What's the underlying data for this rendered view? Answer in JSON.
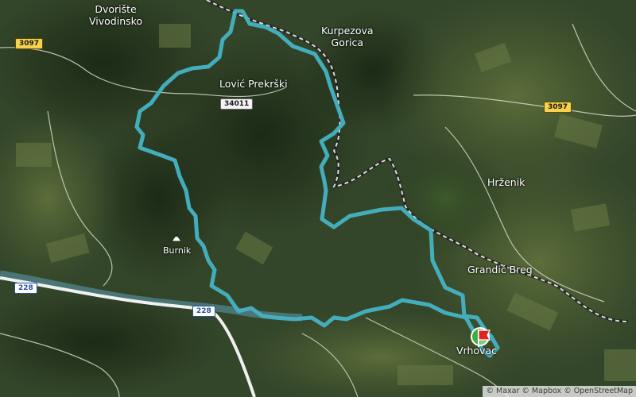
{
  "map": {
    "view": "satellite",
    "colors": {
      "track": "#46b3c4",
      "road": "#e8e8e8",
      "river": "#4e7f82",
      "highway": "#f0f0f0",
      "border": "#1e1e1e",
      "shield_yellow": "#f6d24a",
      "start_marker": "#3fae3f",
      "finish_flag": "#e02424"
    },
    "places": {
      "dvoriste": "Dvorište\nVivodinsko",
      "kurpezova": "Kurpezova\nGorica",
      "lovic": "Lović Prekrški",
      "hrzenik": "Hrženik",
      "grandic": "Grandić Breg",
      "vrhovac": "Vrhovac",
      "burnik": "Burnik"
    },
    "road_shields": {
      "r3097_left": "3097",
      "r3097_right": "3097",
      "r34011": "34011",
      "r228_left": "228",
      "r228_mid": "228"
    },
    "icons": {
      "peak": "mountain-peak-icon",
      "start": "start-marker-icon",
      "finish": "finish-flag-icon"
    },
    "attribution": {
      "maxar": "© Maxar",
      "mapbox": "© Mapbox",
      "osm": "© OpenStreetMap"
    }
  }
}
